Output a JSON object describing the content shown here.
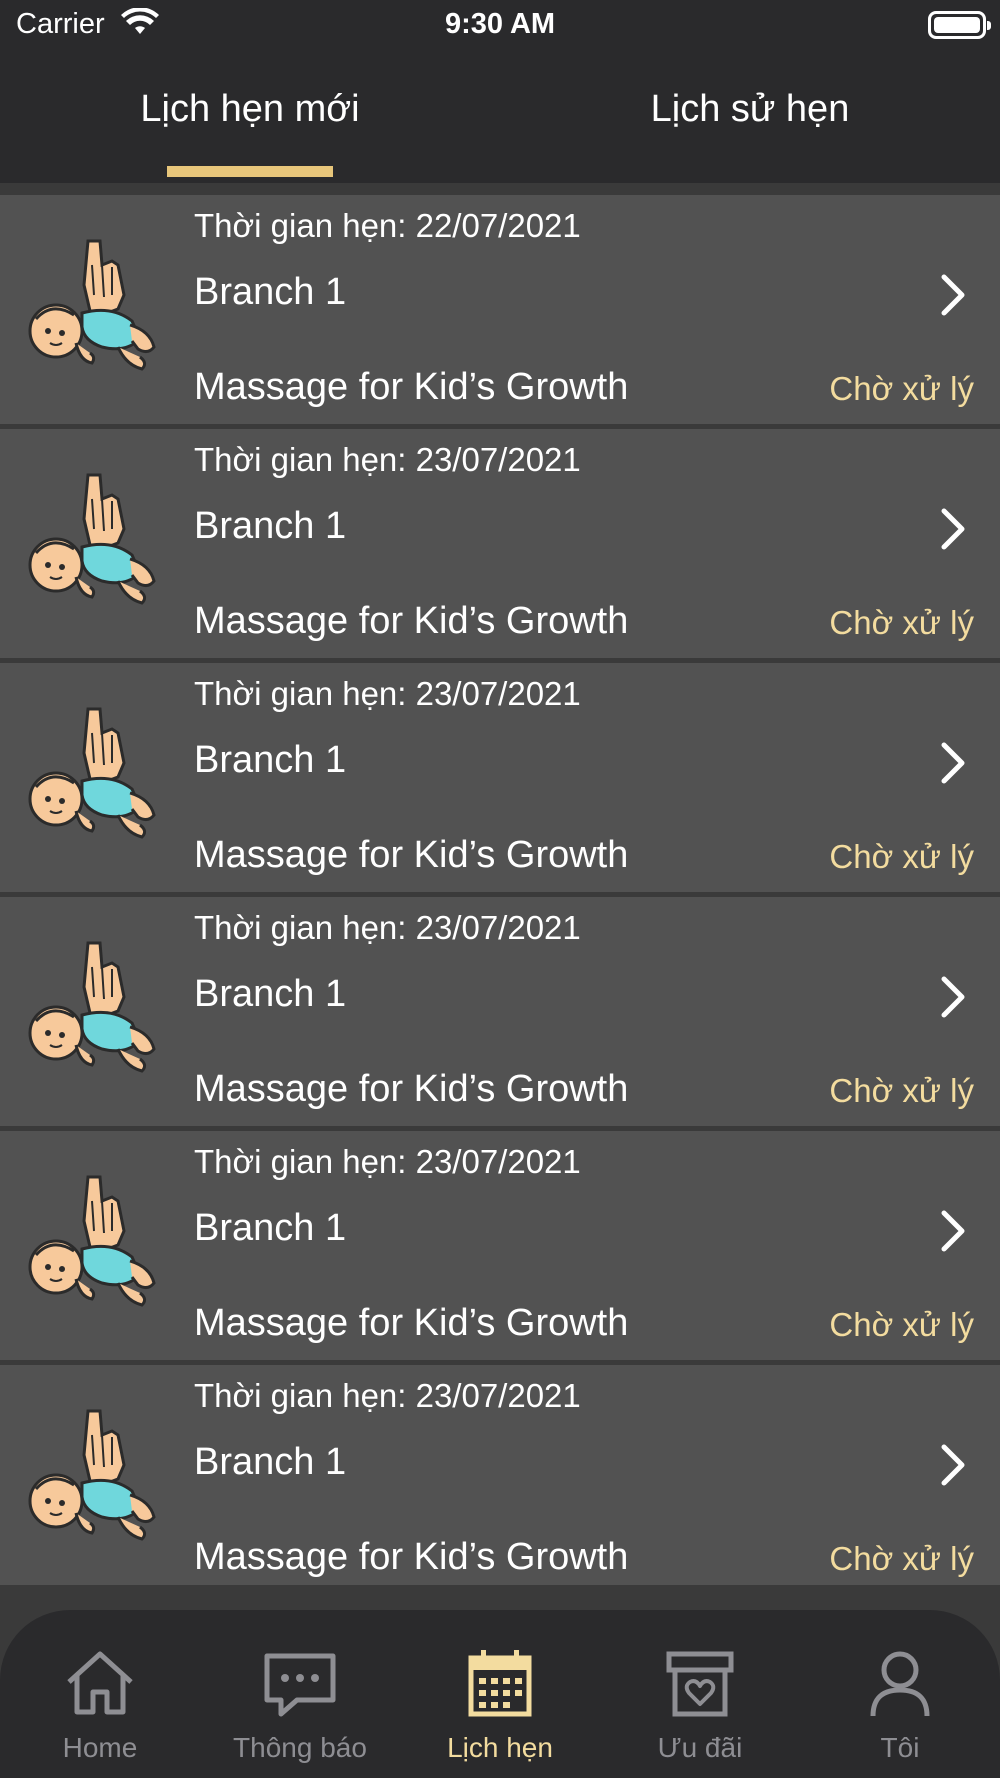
{
  "status_bar": {
    "carrier": "Carrier",
    "time": "9:30 AM"
  },
  "tabs": {
    "new": "Lịch hẹn mới",
    "history": "Lịch sử hẹn"
  },
  "appointments": [
    {
      "date": "Thời gian hẹn: 22/07/2021",
      "branch": "Branch 1",
      "service": "Massage for Kid’s Growth",
      "status": "Chờ xử lý"
    },
    {
      "date": "Thời gian hẹn: 23/07/2021",
      "branch": "Branch 1",
      "service": "Massage for Kid’s Growth",
      "status": "Chờ xử lý"
    },
    {
      "date": "Thời gian hẹn: 23/07/2021",
      "branch": "Branch 1",
      "service": "Massage for Kid’s Growth",
      "status": "Chờ xử lý"
    },
    {
      "date": "Thời gian hẹn: 23/07/2021",
      "branch": "Branch 1",
      "service": "Massage for Kid’s Growth",
      "status": "Chờ xử lý"
    },
    {
      "date": "Thời gian hẹn: 23/07/2021",
      "branch": "Branch 1",
      "service": "Massage for Kid’s Growth",
      "status": "Chờ xử lý"
    },
    {
      "date": "Thời gian hẹn: 23/07/2021",
      "branch": "Branch 1",
      "service": "Massage for Kid’s Growth",
      "status": "Chờ xử lý"
    }
  ],
  "tabbar": [
    {
      "label": "Home",
      "icon": "home-icon"
    },
    {
      "label": "Thông báo",
      "icon": "chat-icon"
    },
    {
      "label": "Lịch hẹn",
      "icon": "calendar-icon",
      "active": true
    },
    {
      "label": "Ưu đãi",
      "icon": "gift-box-icon"
    },
    {
      "label": "Tôi",
      "icon": "user-icon"
    }
  ],
  "colors": {
    "accent": "#e8c67b",
    "status": "#f3dc9f",
    "header_bg": "#2a2a2c",
    "row_bg": "#525252"
  }
}
